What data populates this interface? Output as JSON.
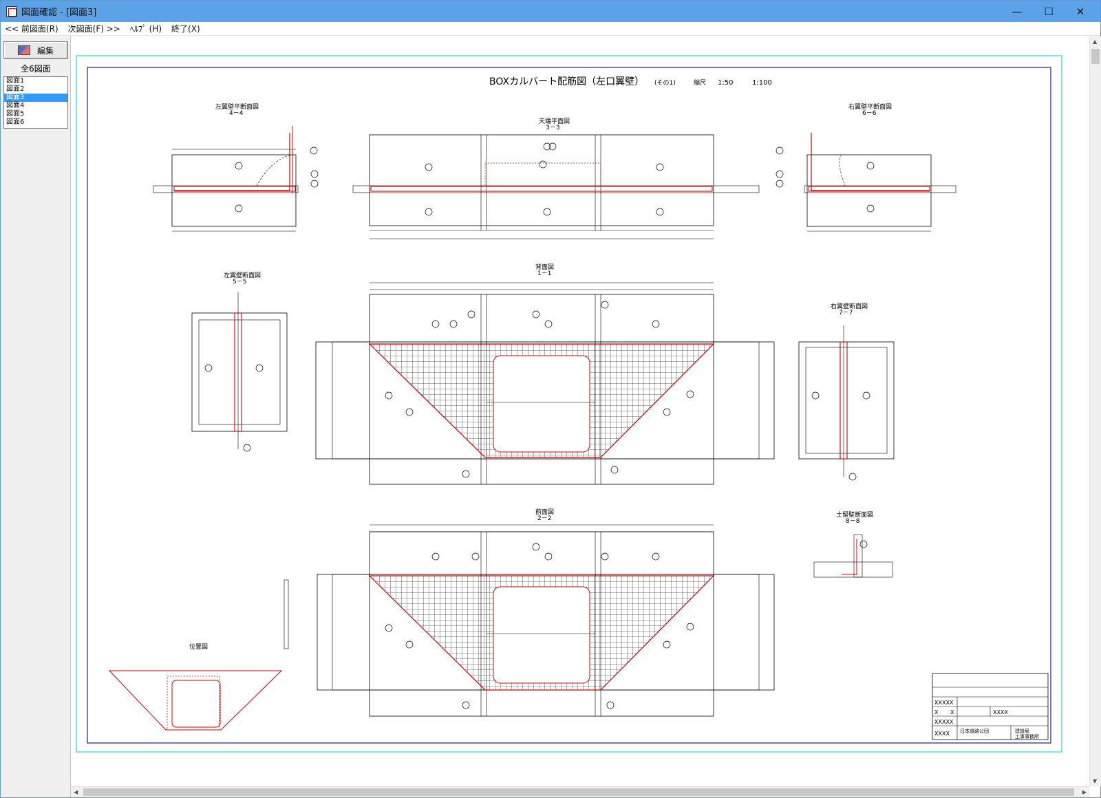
{
  "window": {
    "title": "図面確認 - [図面3]",
    "minimize": "—",
    "maximize": "☐",
    "close": "✕"
  },
  "menu": [
    {
      "label": "<< 前図面(R)"
    },
    {
      "label": "次図面(F) >>"
    },
    {
      "label": "ﾍﾙﾌﾟ (H)"
    },
    {
      "label": "終了(X)"
    }
  ],
  "sidebar": {
    "edit_button": "編集",
    "count_label": "全6図面",
    "drawings": [
      "図面1",
      "図面2",
      "図面3",
      "図面4",
      "図面5",
      "図面6"
    ],
    "selected": "図面3"
  },
  "drawing": {
    "title": "BOXカルバート配筋図（左口翼壁）",
    "sub": "(その1)",
    "scale_label": "縮尺",
    "scale1": "1:50",
    "scale2": "1:100",
    "views": {
      "left_wing_plan": {
        "name": "左翼壁平断面図",
        "section": "4－4"
      },
      "top_slab_plan": {
        "name": "天端平面図",
        "section": "3－3"
      },
      "right_wing_plan": {
        "name": "右翼壁平断面図",
        "section": "6－6"
      },
      "left_wing_section": {
        "name": "左翼壁断面図",
        "section": "5－5"
      },
      "back_view": {
        "name": "背面図",
        "section": "1－1"
      },
      "right_wing_section": {
        "name": "右翼壁断面図",
        "section": "7－7"
      },
      "front_view": {
        "name": "前面図",
        "section": "2－2"
      },
      "parapet_section": {
        "name": "土留壁断面図",
        "section": "8－8"
      },
      "location_plan": {
        "name": "位置図"
      }
    },
    "titleblock": {
      "r1": "XXXXX",
      "r2a": "X",
      "r2b": "X",
      "r2c": "XXXX",
      "r3": "XXXXX",
      "r4a": "XXXX",
      "r4b": "日本道路公団",
      "r4c": "建設局",
      "r4d": "工事事務所"
    },
    "colors": {
      "frame": "#1a1a9c",
      "sheet_border": "#00c8c8",
      "rebar": "#d40000",
      "line": "#000000"
    }
  }
}
